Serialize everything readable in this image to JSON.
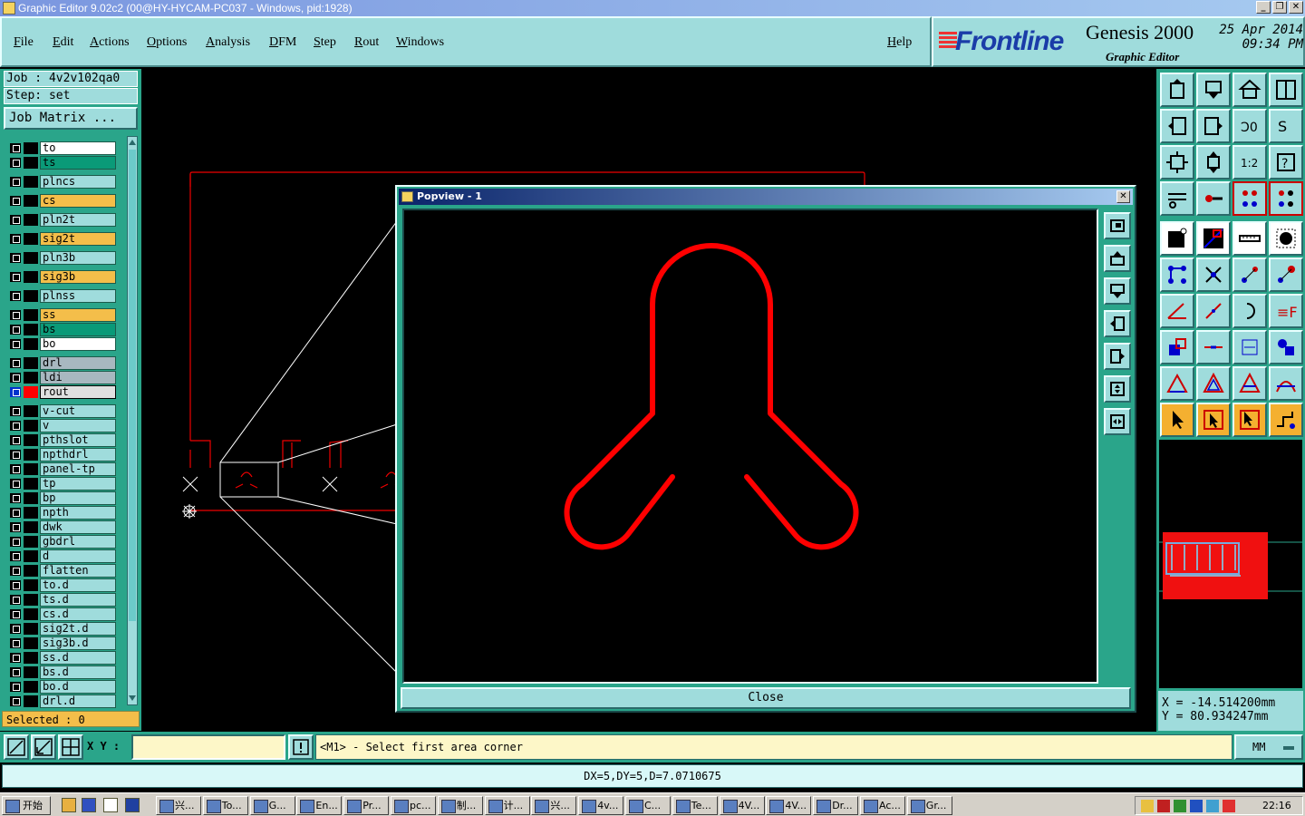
{
  "window": {
    "title": "Graphic Editor 9.02c2 (00@HY-HYCAM-PC037 - Windows, pid:1928)"
  },
  "menu": [
    "File",
    "Edit",
    "Actions",
    "Options",
    "Analysis",
    "DFM",
    "Step",
    "Rout",
    "Windows"
  ],
  "help_label": "Help",
  "brand": {
    "logo": "Frontline",
    "product": "Genesis 2000",
    "subtitle": "Graphic Editor",
    "date": "25 Apr 2014",
    "time": "09:34 PM"
  },
  "job": {
    "job_line": "Job : 4v2v102qa0",
    "step_line": "Step: set",
    "job_matrix": "Job Matrix ..."
  },
  "layers": [
    {
      "name": "to",
      "color": "#ffffff",
      "group": 0
    },
    {
      "name": "ts",
      "color": "#0a9a78",
      "group": 0
    },
    {
      "name": "plncs",
      "color": "#9fdcdc",
      "group": 1
    },
    {
      "name": "cs",
      "color": "#f4be4a",
      "group": 2
    },
    {
      "name": "pln2t",
      "color": "#9fdcdc",
      "group": 3
    },
    {
      "name": "sig2t",
      "color": "#f4be4a",
      "group": 4
    },
    {
      "name": "pln3b",
      "color": "#9fdcdc",
      "group": 5
    },
    {
      "name": "sig3b",
      "color": "#f4be4a",
      "group": 6
    },
    {
      "name": "plnss",
      "color": "#9fdcdc",
      "group": 7
    },
    {
      "name": "ss",
      "color": "#f4be4a",
      "group": 8
    },
    {
      "name": "bs",
      "color": "#0a9a78",
      "group": 8
    },
    {
      "name": "bo",
      "color": "#ffffff",
      "group": 8
    },
    {
      "name": "drl",
      "color": "#a8b8c0",
      "group": 9
    },
    {
      "name": "ldi",
      "color": "#a8b8c0",
      "group": 9
    },
    {
      "name": "rout",
      "color": "#e0e0e0",
      "group": 9,
      "active": true
    },
    {
      "name": "v-cut",
      "color": "#9fdcdc",
      "group": 10
    },
    {
      "name": "v",
      "color": "#9fdcdc",
      "group": 10
    },
    {
      "name": "pthslot",
      "color": "#9fdcdc",
      "group": 10
    },
    {
      "name": "npthdrl",
      "color": "#9fdcdc",
      "group": 10
    },
    {
      "name": "panel-tp",
      "color": "#9fdcdc",
      "group": 10
    },
    {
      "name": "tp",
      "color": "#9fdcdc",
      "group": 10
    },
    {
      "name": "bp",
      "color": "#9fdcdc",
      "group": 10
    },
    {
      "name": "npth",
      "color": "#9fdcdc",
      "group": 10
    },
    {
      "name": "dwk",
      "color": "#9fdcdc",
      "group": 10
    },
    {
      "name": "gbdrl",
      "color": "#9fdcdc",
      "group": 10
    },
    {
      "name": "d",
      "color": "#9fdcdc",
      "group": 10
    },
    {
      "name": "flatten",
      "color": "#9fdcdc",
      "group": 10
    },
    {
      "name": "to.d",
      "color": "#9fdcdc",
      "group": 10
    },
    {
      "name": "ts.d",
      "color": "#9fdcdc",
      "group": 10
    },
    {
      "name": "cs.d",
      "color": "#9fdcdc",
      "group": 10
    },
    {
      "name": "sig2t.d",
      "color": "#9fdcdc",
      "group": 10
    },
    {
      "name": "sig3b.d",
      "color": "#9fdcdc",
      "group": 10
    },
    {
      "name": "ss.d",
      "color": "#9fdcdc",
      "group": 10
    },
    {
      "name": "bs.d",
      "color": "#9fdcdc",
      "group": 10
    },
    {
      "name": "bo.d",
      "color": "#9fdcdc",
      "group": 10
    },
    {
      "name": "drl.d",
      "color": "#9fdcdc",
      "group": 10
    }
  ],
  "selected": "Selected : 0",
  "popview": {
    "title": "Popview - 1",
    "close_label": "Close"
  },
  "coords": {
    "x": "X  =  -14.514200mm",
    "y": "Y  =  80.934247mm"
  },
  "cmd": {
    "xy_label": "X Y :",
    "xy_value": "",
    "prompt": "<M1> - Select first area corner",
    "units": "MM"
  },
  "status": "DX=5,DY=5,D=7.0710675",
  "taskbar": {
    "start": "开始",
    "tasks": [
      "兴...",
      "To...",
      "G...",
      "En...",
      "Pr...",
      "pc...",
      "制...",
      "计...",
      "兴...",
      "4v...",
      "C...",
      "Te...",
      "4V...",
      "4V...",
      "Dr...",
      "Ac...",
      "Gr..."
    ],
    "clock": "22:16"
  },
  "colors": {
    "teal": "#2aa58a",
    "panel": "#9fdcdc",
    "rout": "#ff0000",
    "accent": "#1a3ca8"
  }
}
